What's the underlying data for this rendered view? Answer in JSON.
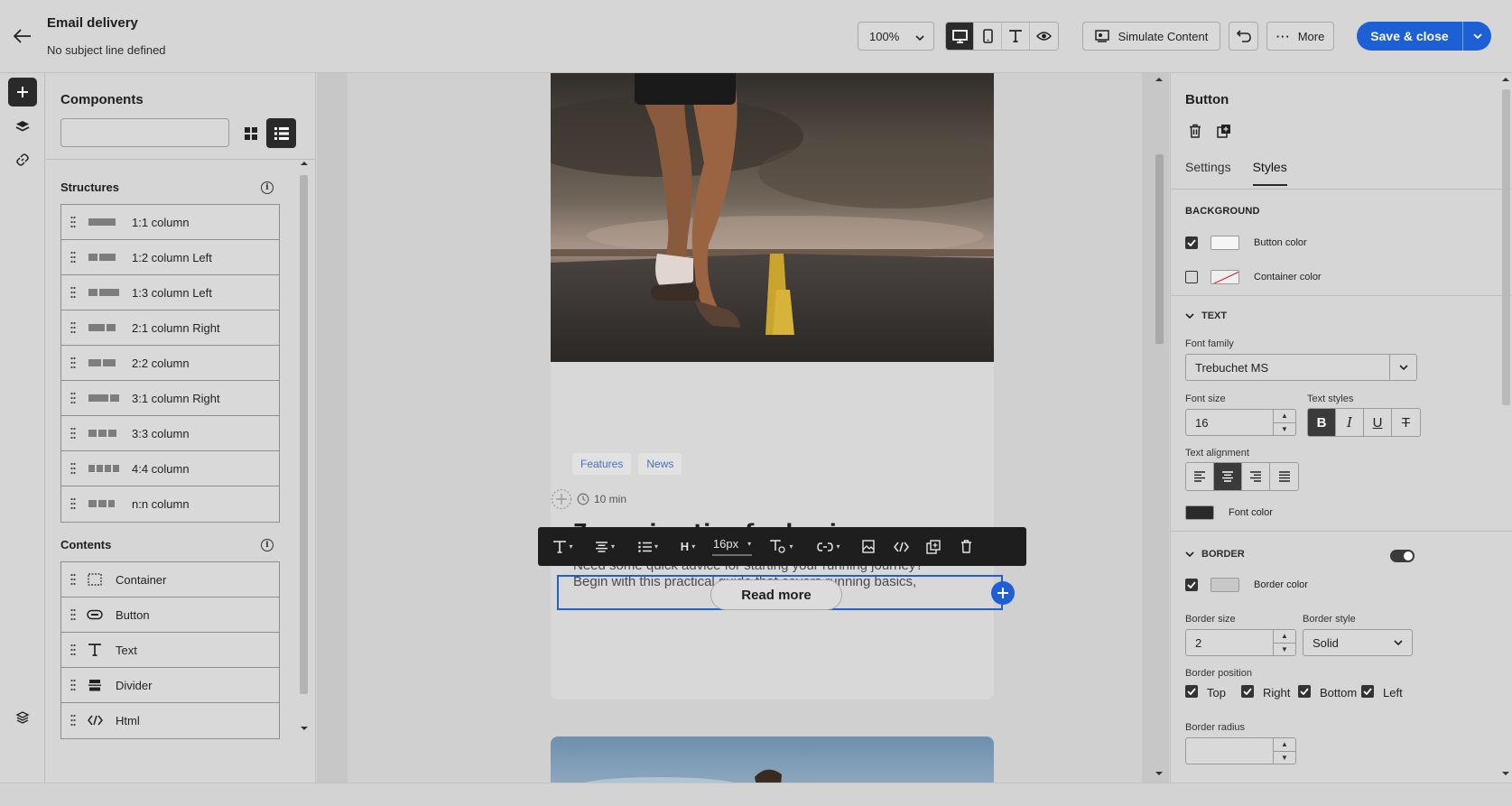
{
  "header": {
    "title": "Email delivery",
    "subtitle": "No subject line defined",
    "zoom": "100%",
    "simulate_label": "Simulate Content",
    "more_label": "More",
    "save_label": "Save & close"
  },
  "rail": {
    "items": [
      "add-icon",
      "layers-icon",
      "link-icon",
      "asset-icon"
    ]
  },
  "components": {
    "title": "Components",
    "search_placeholder": "",
    "structures_title": "Structures",
    "structures": [
      {
        "label": "1:1 column"
      },
      {
        "label": "1:2 column Left"
      },
      {
        "label": "1:3 column Left"
      },
      {
        "label": "2:1 column Right"
      },
      {
        "label": "2:2 column"
      },
      {
        "label": "3:1 column Right"
      },
      {
        "label": "3:3 column"
      },
      {
        "label": "4:4 column"
      },
      {
        "label": "n:n column"
      }
    ],
    "contents_title": "Contents",
    "contents": [
      {
        "label": "Container",
        "icon": "container-icon"
      },
      {
        "label": "Button",
        "icon": "button-icon"
      },
      {
        "label": "Text",
        "icon": "text-icon"
      },
      {
        "label": "Divider",
        "icon": "divider-icon"
      },
      {
        "label": "Html",
        "icon": "code-icon"
      }
    ]
  },
  "canvas": {
    "tags": [
      "Features",
      "News"
    ],
    "read_time": "10 min",
    "card_title": "7 running tips for beginners",
    "card_desc_line1": "Need some quick advice for starting your running journey?",
    "card_desc_line2": "Begin with this practical guide that covers running basics,",
    "button_label": "Read more",
    "toolbar": {
      "font_size": "16px"
    }
  },
  "props": {
    "title": "Button",
    "tabs": [
      "Settings",
      "Styles"
    ],
    "active_tab": "Styles",
    "background_title": "BACKGROUND",
    "button_color_label": "Button color",
    "container_color_label": "Container color",
    "text_title": "TEXT",
    "font_family_label": "Font family",
    "font_family": "Trebuchet MS",
    "font_size_label": "Font size",
    "font_size": "16",
    "text_styles_label": "Text styles",
    "text_alignment_label": "Text alignment",
    "font_color_label": "Font color",
    "border_title": "BORDER",
    "border_color_label": "Border color",
    "border_size_label": "Border size",
    "border_size": "2",
    "border_style_label": "Border style",
    "border_style": "Solid",
    "border_position_label": "Border position",
    "positions": [
      "Top",
      "Right",
      "Bottom",
      "Left"
    ],
    "border_radius_label": "Border radius",
    "colors": {
      "font": "#2a2a2a",
      "border": "#c8c8c8",
      "button": "#ffffff",
      "accent": "#1d5fd4"
    }
  }
}
